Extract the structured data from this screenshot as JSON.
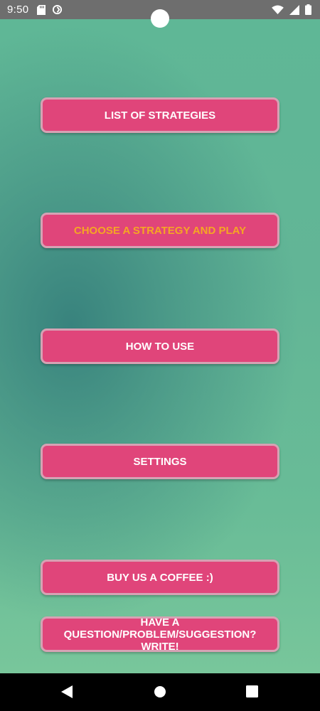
{
  "status_bar": {
    "time": "9:50",
    "left_icons": [
      "sd-card-icon",
      "sync-icon"
    ],
    "right_icons": [
      "wifi-icon",
      "cellular-signal-icon",
      "battery-icon"
    ]
  },
  "menu": {
    "list_of_strategies": "LIST OF STRATEGIES",
    "choose_and_play": "CHOOSE A STRATEGY AND PLAY",
    "how_to_use": "HOW TO USE",
    "settings": "SETTINGS",
    "buy_coffee": "BUY US A COFFEE :)",
    "feedback": "HAVE A QUESTION/PROBLEM/SUGGESTION? WRITE!"
  },
  "navigation": {
    "buttons": [
      "back-icon",
      "home-icon",
      "recents-icon"
    ]
  },
  "colors": {
    "button_bg": "#e0457a",
    "button_border": "#d6a2b4",
    "highlight_text": "#f5a623",
    "background_teal": "#36807c",
    "background_green": "#78c69b"
  }
}
